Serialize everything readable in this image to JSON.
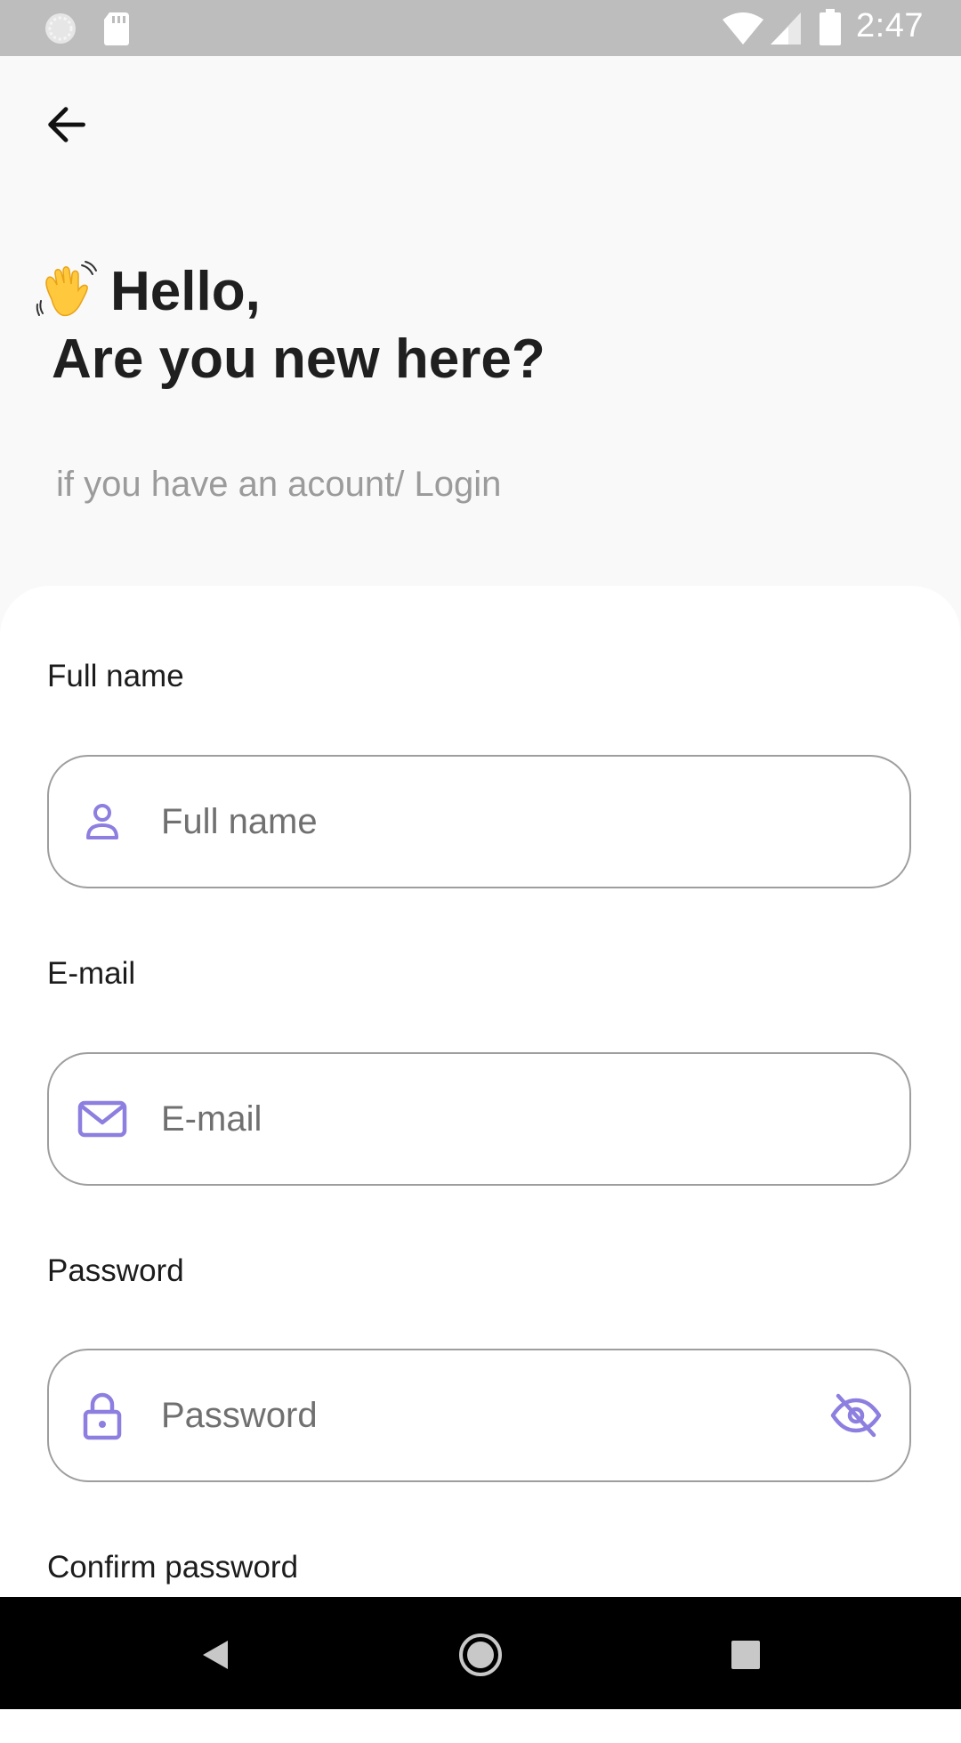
{
  "status_bar": {
    "time": "2:47"
  },
  "header": {
    "back_icon": "arrow-left-icon",
    "greeting_emoji": "waving-hand",
    "greeting": "Hello,",
    "title": "Are you new here?",
    "login_prompt": "if you have an acount/ Login"
  },
  "form": {
    "full_name": {
      "label": "Full name",
      "placeholder": "Full name",
      "icon": "person-icon"
    },
    "email": {
      "label": "E-mail",
      "placeholder": "E-mail",
      "icon": "mail-icon"
    },
    "password": {
      "label": "Password",
      "placeholder": "Password",
      "icon": "lock-icon",
      "toggle_icon": "eye-off-icon"
    },
    "confirm_password": {
      "label": "Confirm password"
    }
  },
  "colors": {
    "accent": "#8c7fe0",
    "field_border": "#9e9e9e",
    "subtitle": "#9b9b9b",
    "status_bar": "#bdbdbd"
  }
}
